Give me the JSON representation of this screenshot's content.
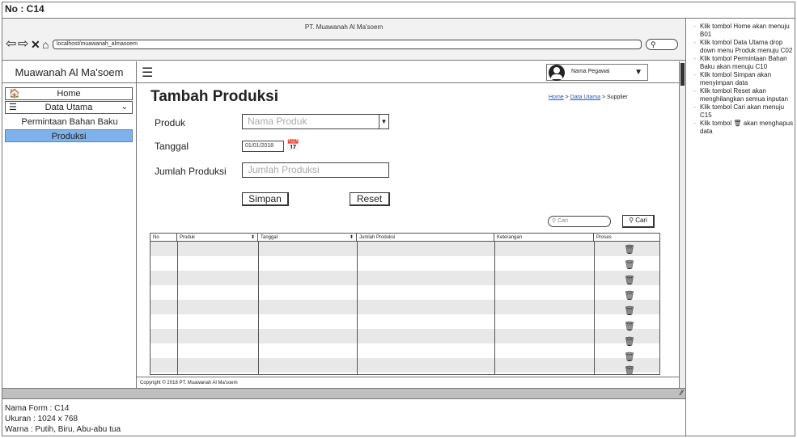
{
  "form_number": "No : C14",
  "browser": {
    "title": "PT. Muawanah Al Ma'soem",
    "url": "localhost/muawanah_almasoem",
    "search_icon": "magnifier"
  },
  "brand": "Muawanah Al Ma'soem",
  "sidebar": {
    "items": [
      {
        "label": "Home",
        "icon": "home-icon"
      },
      {
        "label": "Data Utama",
        "icon": "database-icon"
      },
      {
        "label": "Permintaan Bahan Baku"
      },
      {
        "label": "Produksi",
        "active": true
      }
    ]
  },
  "header": {
    "user_name": "Nama Pegawai"
  },
  "page": {
    "title": "Tambah Produksi",
    "breadcrumb": [
      "Home",
      "Data Utama",
      "Supplier"
    ],
    "breadcrumb_sep": ">"
  },
  "form": {
    "produk_label": "Produk",
    "produk_placeholder": "Nama Produk",
    "tanggal_label": "Tanggal",
    "tanggal_value": "01/01/2018",
    "jumlah_label": "Jumlah Produksi",
    "jumlah_placeholder": "Jumlah Produksi",
    "simpan_label": "Simpan",
    "reset_label": "Reset"
  },
  "search": {
    "placeholder": "Cari",
    "button_label": "Cari"
  },
  "table": {
    "columns": [
      "No",
      "Produk",
      "Tanggal",
      "Jumlah Produksi",
      "Keterangan",
      "Proses"
    ]
  },
  "footer": "Copyright © 2018 PT. Muawanah Al Ma'soem",
  "meta": {
    "nama_form": "Nama Form : C14",
    "ukuran": "Ukuran : 1024 x 768",
    "warna": "Warna : Putih, Biru, Abu-abu tua"
  },
  "notes": [
    "Klik tombol Home akan menuju B01",
    "Klik tombol Data Utama drop down menu Produk menuju C02",
    "Klik tombol Permintaan Bahan Baku akan menuju C10",
    "Klik tombol Simpan akan menyimpan data",
    "Klik tombol Reset akan menghilangkan semua inputan",
    "Klik tombol Cari akan menuju C15",
    "Klik tombol",
    "akan menghapus data"
  ]
}
